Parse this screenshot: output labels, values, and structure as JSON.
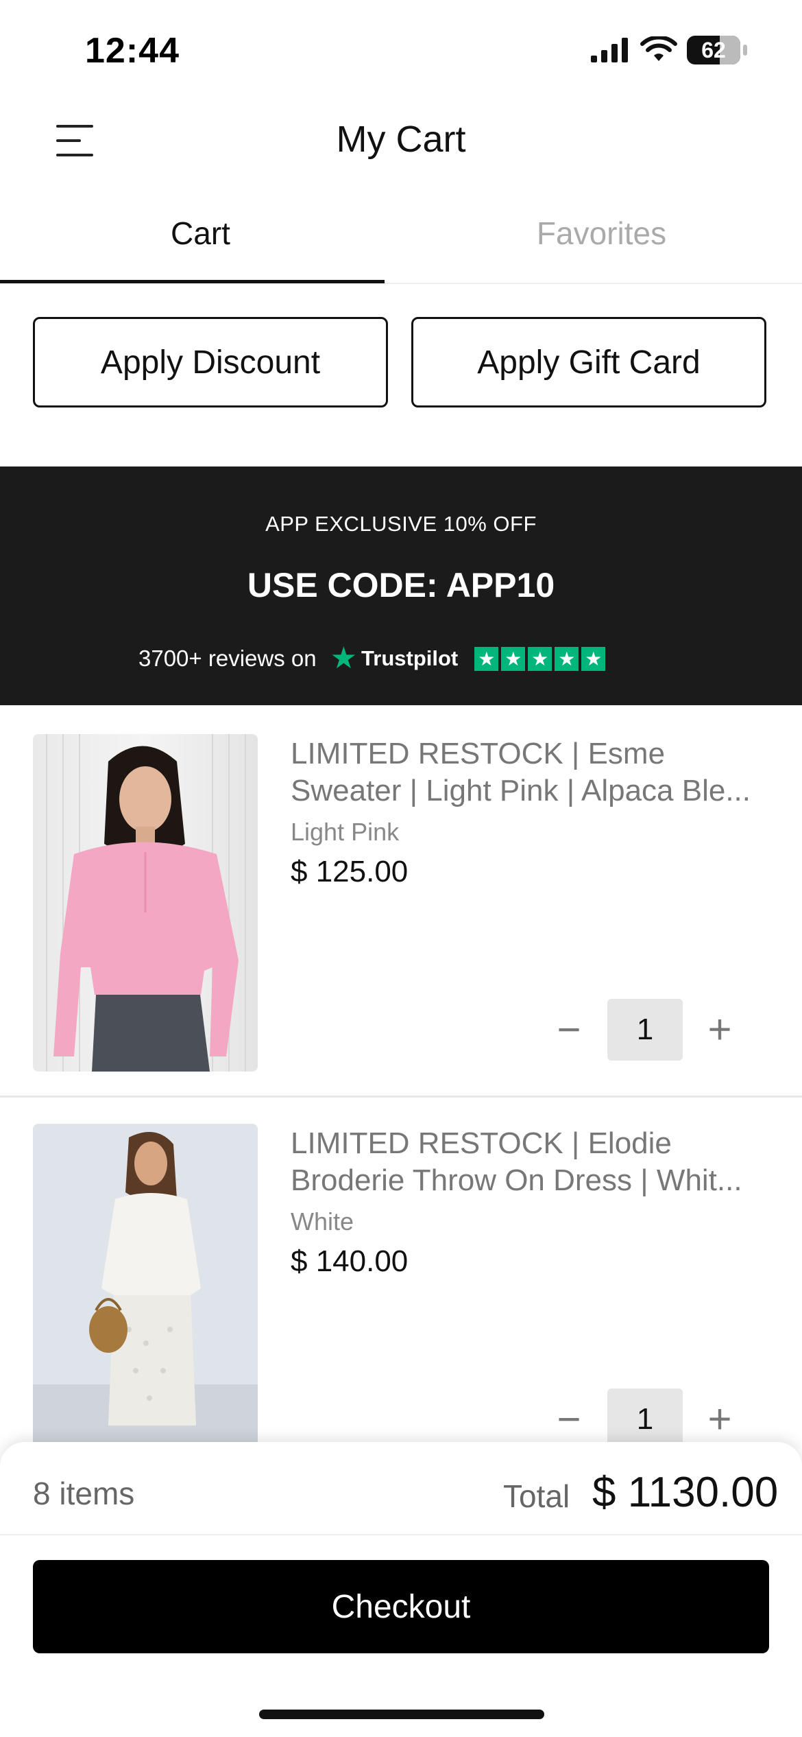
{
  "status_bar": {
    "time": "12:44",
    "battery": "62"
  },
  "header": {
    "title": "My Cart"
  },
  "tabs": [
    {
      "label": "Cart",
      "active": true
    },
    {
      "label": "Favorites",
      "active": false
    }
  ],
  "actions": {
    "discount_label": "Apply Discount",
    "gift_card_label": "Apply Gift Card"
  },
  "promo": {
    "line1": "APP EXCLUSIVE 10% OFF",
    "line2": "USE CODE: APP10",
    "reviews_text": "3700+ reviews on",
    "trustpilot_word": "Trustpilot",
    "rating_stars": 5,
    "brand_color": "#00b67a"
  },
  "products": [
    {
      "title": "LIMITED RESTOCK | Esme Sweater | Light Pink | Alpaca Ble...",
      "variant": "Light Pink",
      "price": "$ 125.00",
      "quantity": "1"
    },
    {
      "title": "LIMITED RESTOCK | Elodie Broderie Throw On Dress | Whit...",
      "variant": "White",
      "price": "$ 140.00",
      "quantity": "1"
    }
  ],
  "summary": {
    "items_count": "8 items",
    "total_label": "Total",
    "total_value": "$ 1130.00",
    "checkout_label": "Checkout"
  },
  "icons": {
    "menu": "menu-icon",
    "minus": "minus-icon",
    "plus": "plus-icon",
    "signal": "signal-icon",
    "wifi": "wifi-icon",
    "battery": "battery-icon",
    "trustpilot_star": "star-icon"
  }
}
